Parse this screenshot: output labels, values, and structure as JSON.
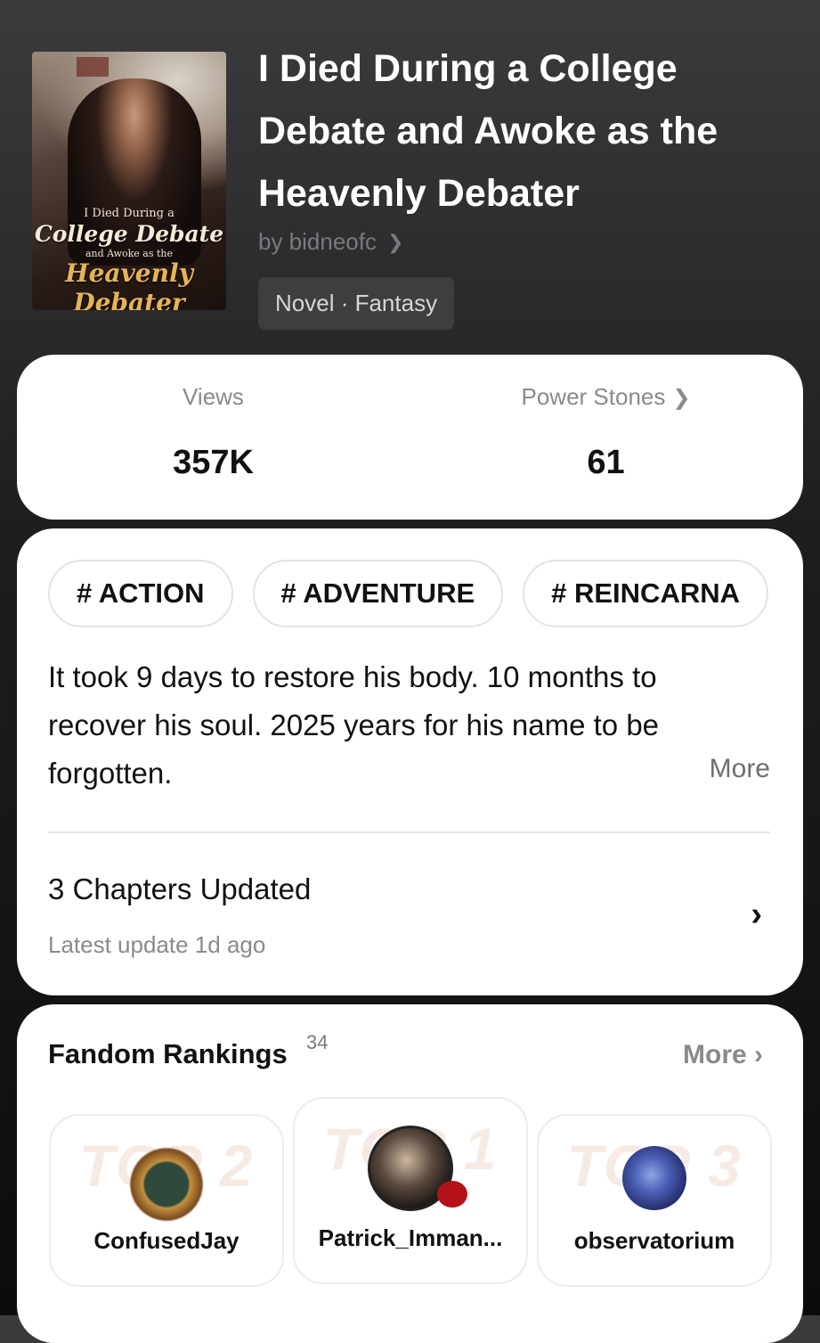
{
  "book": {
    "title": "I Died During a College Debate and Awoke as the Heavenly Debater",
    "author": "by bidneofc",
    "genre": "Novel · Fantasy",
    "cover": {
      "line1": "I Died During a",
      "line2": "College Debate",
      "line3": "and Awoke as the",
      "line4": "Heavenly Debater"
    }
  },
  "stats": {
    "views_label": "Views",
    "views_value": "357K",
    "power_label": "Power Stones",
    "power_value": "61"
  },
  "tags": [
    "# ACTION",
    "# ADVENTURE",
    "# REINCARNA"
  ],
  "synopsis": {
    "text": "It took 9 days to restore his body. 10 months to recover his soul. 2025 years for his name to be forgotten.",
    "more_label": "More"
  },
  "chapters": {
    "title": "3 Chapters Updated",
    "subtitle": "Latest update 1d ago"
  },
  "fandom": {
    "title": "Fandom Rankings",
    "count": "34",
    "more_label": "More ›",
    "rankings": [
      {
        "watermark": "TOP 2",
        "name": "ConfusedJay"
      },
      {
        "watermark": "TOP 1",
        "name": "Patrick_Imman..."
      },
      {
        "watermark": "TOP 3",
        "name": "observatorium"
      }
    ]
  }
}
